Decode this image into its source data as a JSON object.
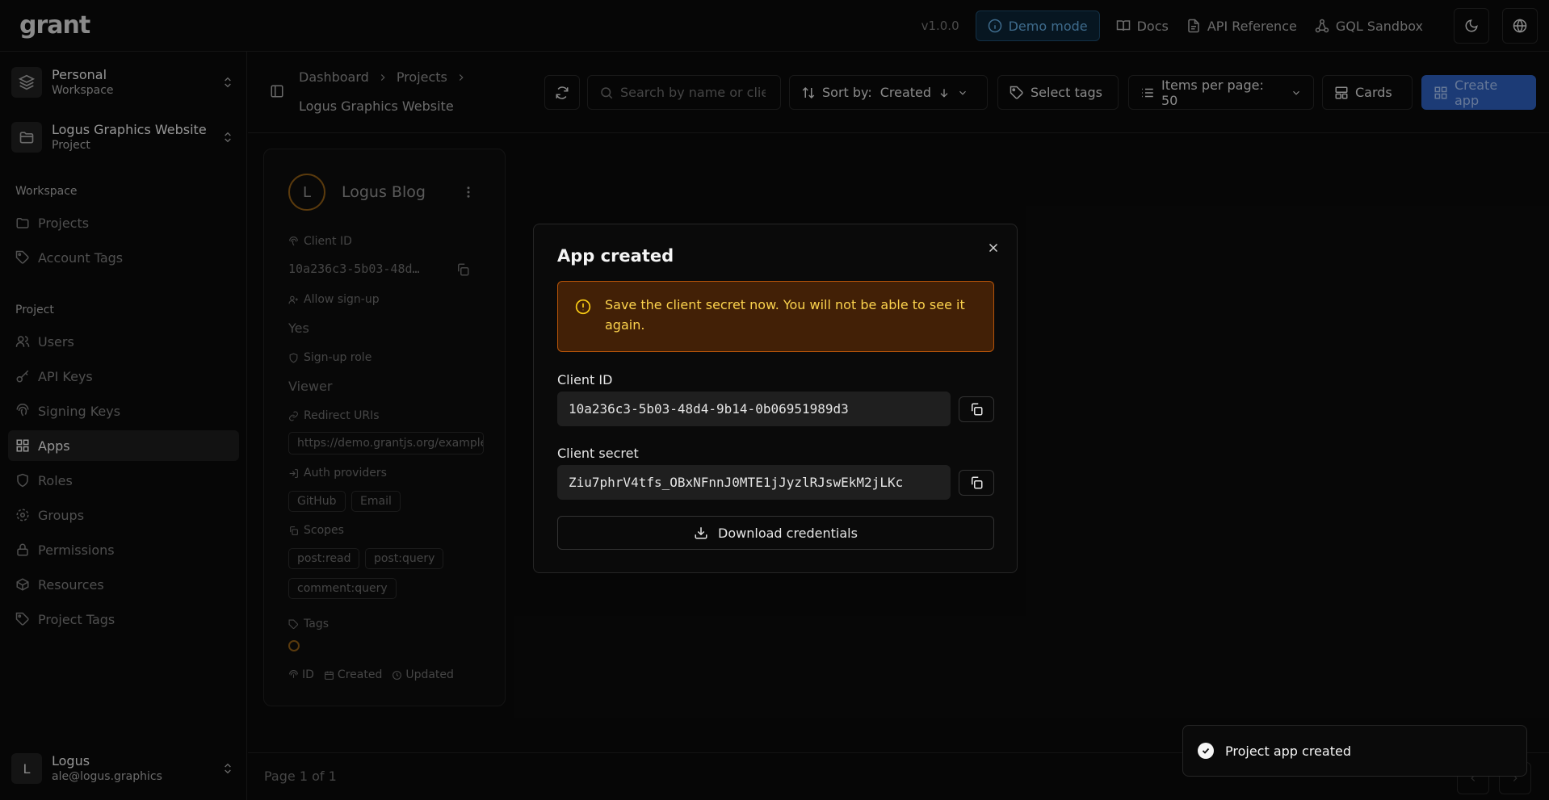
{
  "app": {
    "logo": "grant",
    "version": "v1.0.0"
  },
  "topbar": {
    "demo_label": "Demo mode",
    "links": [
      {
        "label": "Docs",
        "icon": "book-icon"
      },
      {
        "label": "API Reference",
        "icon": "file-icon"
      },
      {
        "label": "GQL Sandbox",
        "icon": "graph-icon"
      }
    ],
    "theme_icon": "moon-icon",
    "language_icon": "globe-icon"
  },
  "sidebar": {
    "workspace_switcher": {
      "title": "Personal",
      "subtitle": "Workspace"
    },
    "project_switcher": {
      "title": "Logus Graphics Website",
      "subtitle": "Project"
    },
    "workspace_label": "Workspace",
    "workspace_items": [
      {
        "label": "Projects",
        "icon": "folder-icon"
      },
      {
        "label": "Account Tags",
        "icon": "tag-icon"
      }
    ],
    "project_label": "Project",
    "project_items": [
      {
        "label": "Users",
        "icon": "users-icon"
      },
      {
        "label": "API Keys",
        "icon": "key-icon"
      },
      {
        "label": "Signing Keys",
        "icon": "fingerprint-icon"
      },
      {
        "label": "Apps",
        "icon": "grid-icon",
        "active": true
      },
      {
        "label": "Roles",
        "icon": "shield-icon"
      },
      {
        "label": "Groups",
        "icon": "groups-icon"
      },
      {
        "label": "Permissions",
        "icon": "lock-icon"
      },
      {
        "label": "Resources",
        "icon": "box-icon"
      },
      {
        "label": "Project Tags",
        "icon": "tag-icon"
      }
    ],
    "user": {
      "initial": "L",
      "name": "Logus",
      "email": "ale@logus.graphics"
    }
  },
  "header": {
    "breadcrumbs": [
      "Dashboard",
      "Projects"
    ],
    "current": "Logus Graphics Website",
    "search_placeholder": "Search by name or client ID",
    "sort_label": "Sort by:",
    "sort_value": "Created",
    "tags_label": "Select tags",
    "items_per_page_label": "Items per page: 50",
    "view_label": "Cards",
    "create_label": "Create app"
  },
  "card": {
    "initial": "L",
    "title": "Logus Blog",
    "client_id_label": "Client ID",
    "client_id_value": "10a236c3-5b03-48d…",
    "allow_signup_label": "Allow sign-up",
    "allow_signup_value": "Yes",
    "signup_role_label": "Sign-up role",
    "signup_role_value": "Viewer",
    "redirect_label": "Redirect URIs",
    "redirect_value": "https://demo.grantjs.org/example/",
    "auth_label": "Auth providers",
    "auth_providers": [
      "GitHub",
      "Email"
    ],
    "scopes_label": "Scopes",
    "scopes": [
      "post:read",
      "post:query",
      "comment:query"
    ],
    "tags_label": "Tags",
    "meta": [
      "ID",
      "Created",
      "Updated"
    ]
  },
  "footer": {
    "page_info": "Page 1 of 1"
  },
  "modal": {
    "title": "App created",
    "warning": "Save the client secret now. You will not be able to see it again.",
    "client_id_label": "Client ID",
    "client_id_value": "10a236c3-5b03-48d4-9b14-0b06951989d3",
    "client_secret_label": "Client secret",
    "client_secret_value": "Ziu7phrV4tfs_OBxNFnnJ0MTE1jJyzlRJswEkM2jLKc",
    "download_label": "Download credentials"
  },
  "toast": {
    "message": "Project app created"
  },
  "colors": {
    "accent": "#2b5bb5",
    "warning_bg": "#422006",
    "warning_border": "#b45309",
    "warning_text": "#fcd34d"
  }
}
